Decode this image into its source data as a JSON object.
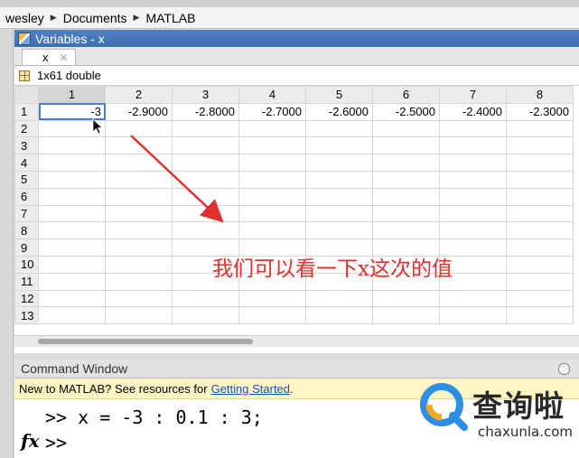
{
  "breadcrumb": [
    "wesley",
    "Documents",
    "MATLAB"
  ],
  "variables_window": {
    "title": "Variables - x",
    "tab_label": "x",
    "size_info": "1x61 double",
    "column_headers": [
      "1",
      "2",
      "3",
      "4",
      "5",
      "6",
      "7",
      "8"
    ],
    "row_headers": [
      "1",
      "2",
      "3",
      "4",
      "5",
      "6",
      "7",
      "8",
      "9",
      "10",
      "11",
      "12",
      "13"
    ],
    "row1_values": [
      "-3",
      "-2.9000",
      "-2.8000",
      "-2.7000",
      "-2.6000",
      "-2.5000",
      "-2.4000",
      "-2.3000"
    ]
  },
  "annotation": "我们可以看一下x这次的值",
  "command_window": {
    "title": "Command Window",
    "notice_text": "New to MATLAB? See resources for",
    "notice_link": "Getting Started",
    "notice_end": ".",
    "line1": ">> x = -3 : 0.1 : 3;",
    "prompt": ">>",
    "fx_label": "fx"
  },
  "watermark": {
    "brand": "查询啦",
    "url": "chaxunla.com"
  },
  "colors": {
    "title_bar": "#4a7fc2",
    "annotation": "#e03030",
    "notice_bg": "#fdf5c4",
    "link": "#1a4fc0"
  }
}
